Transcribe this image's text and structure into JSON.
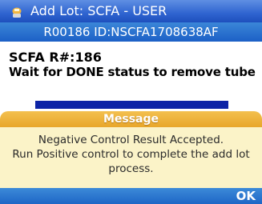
{
  "titlebar": {
    "title": "Add Lot: SCFA - USER",
    "icon": "app-icon"
  },
  "subbar": {
    "text": "R00186 ID:NSCFA1708638AF"
  },
  "content": {
    "line1": "SCFA R#:186",
    "line2": "Wait for DONE status to remove tube",
    "progress_fraction": 1.0
  },
  "dialog": {
    "header": "Message",
    "message_lines": [
      "Negative Control Result Accepted.",
      "Run Positive control to complete the add lot",
      "process."
    ],
    "ok_label": "OK"
  },
  "colors": {
    "titlebar": "#2f64d0",
    "progress_fill": "#0d24a6",
    "dialog_header": "#e8a62a",
    "dialog_body": "#fbf3c8"
  }
}
